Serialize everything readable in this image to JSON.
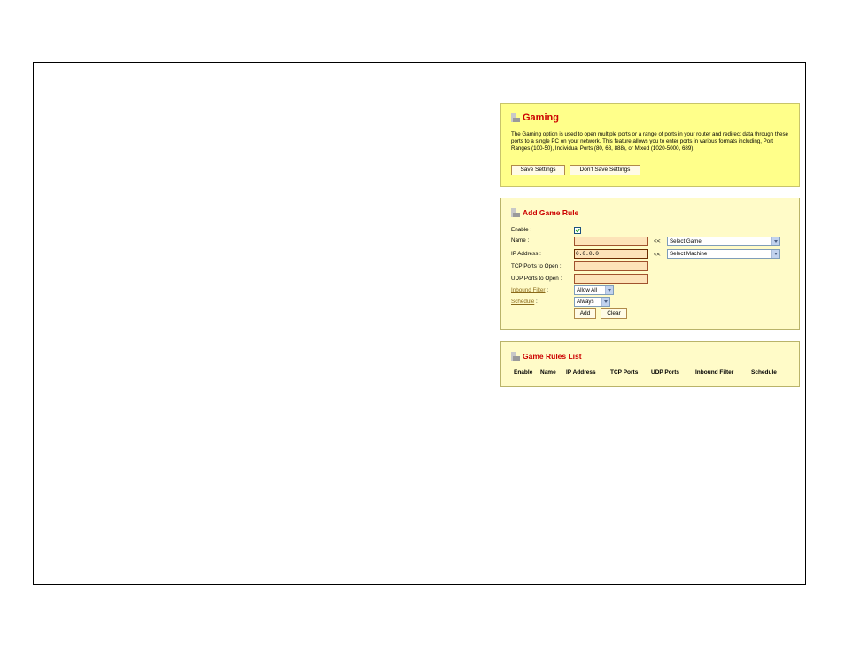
{
  "gaming": {
    "title": "Gaming",
    "description": "The Gaming option is used to open multiple ports or a range of ports in your router and redirect data through these ports to a single PC on your network. This feature allows you to enter ports in various formats including, Port Ranges (100-50), Individual Ports (80, 68, 888), or Mixed (1020-5000, 689).",
    "save_label": "Save Settings",
    "dont_save_label": "Don't Save Settings"
  },
  "add_rule": {
    "title": "Add Game Rule",
    "enable_label": "Enable :",
    "enable_checked": true,
    "name_label": "Name :",
    "name_value": "",
    "game_arrows": "<<",
    "game_select": "Select Game",
    "ip_label": "IP Address :",
    "ip_value": "0.0.0.0",
    "machine_arrows": "<<",
    "machine_select": "Select Machine",
    "tcp_label": "TCP Ports to Open :",
    "tcp_value": "",
    "udp_label": "UDP Ports to Open :",
    "udp_value": "",
    "inbound_label": "Inbound Filter",
    "inbound_colon": " :",
    "inbound_value": "Allow All",
    "schedule_label": "Schedule",
    "schedule_colon": " :",
    "schedule_value": "Always",
    "add_label": "Add",
    "clear_label": "Clear"
  },
  "rules_list": {
    "title": "Game Rules List",
    "columns": [
      "Enable",
      "Name",
      "IP Address",
      "TCP Ports",
      "UDP Ports",
      "Inbound Filter",
      "Schedule"
    ]
  },
  "colors": {
    "title_red": "#cc0000",
    "gaming_bg": "#ffff8a",
    "panel_bg": "#fffbc8",
    "field_bg": "#fde3b8"
  }
}
